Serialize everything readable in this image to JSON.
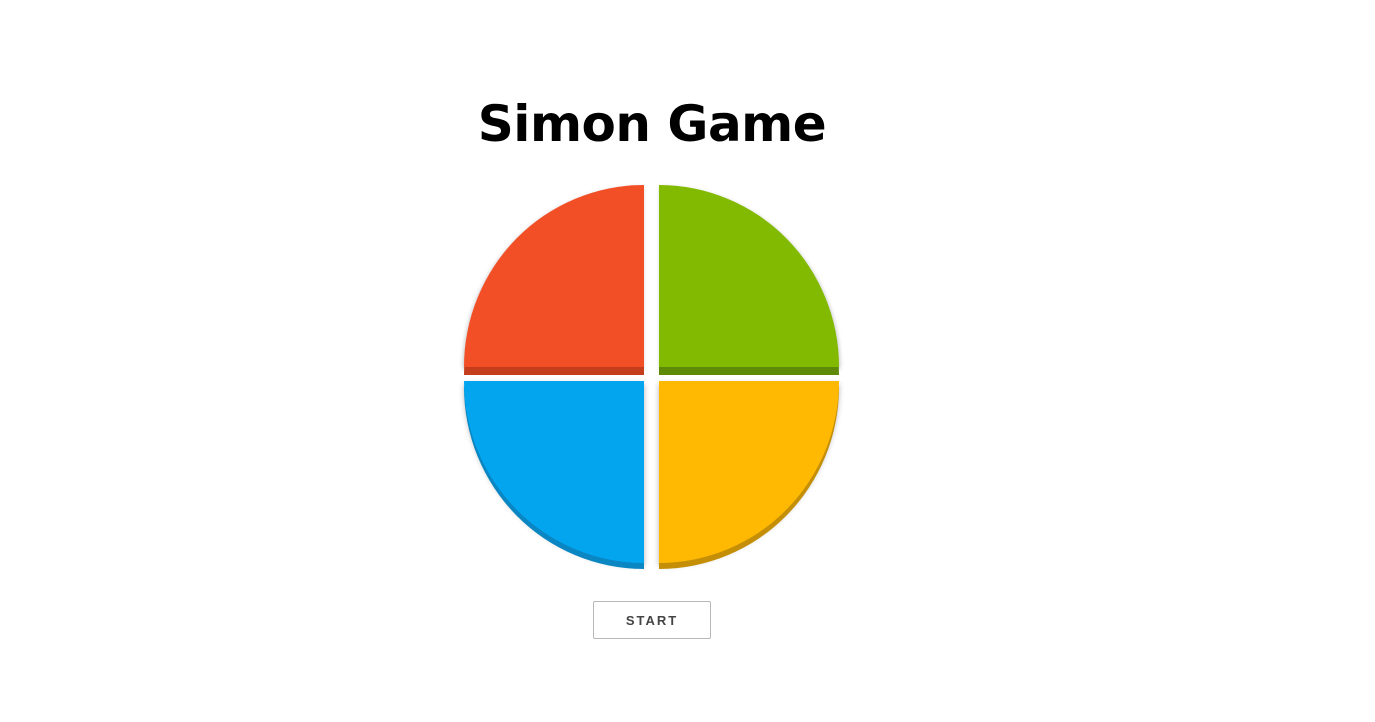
{
  "title": "Simon Game",
  "pads": [
    {
      "name": "red",
      "color": "#f24f26"
    },
    {
      "name": "green",
      "color": "#82b901"
    },
    {
      "name": "blue",
      "color": "#03a5ef"
    },
    {
      "name": "yellow",
      "color": "#ffb903"
    }
  ],
  "controls": {
    "start_label": "START"
  }
}
